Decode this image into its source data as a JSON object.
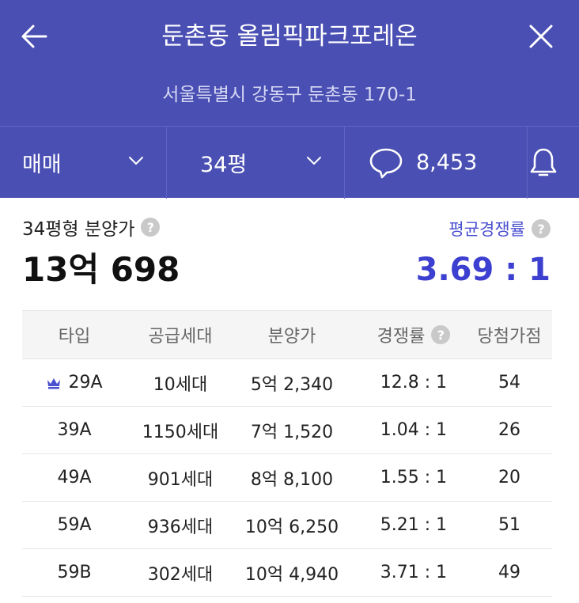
{
  "header": {
    "title": "둔촌동 올림픽파크포레온",
    "address": "서울특별시 강동구 둔촌동 170-1",
    "back_icon": "arrow-left-icon",
    "close_icon": "close-icon"
  },
  "filters": {
    "trade_type": "매매",
    "area": "34평",
    "comment_count": "8,453",
    "comment_icon": "speech-bubble-icon",
    "alarm_icon": "bell-icon"
  },
  "summary": {
    "price_label": "34평형 분양가",
    "price_value": "13억 698",
    "competition_label": "평균경쟁률",
    "competition_value": "3.69 : 1",
    "help_glyph": "?"
  },
  "table": {
    "headers": [
      "타입",
      "공급세대",
      "분양가",
      "경쟁률",
      "당첨가점"
    ],
    "rows": [
      {
        "type": "29A",
        "units": "10세대",
        "price": "5억 2,340",
        "rate": "12.8 : 1",
        "score": "54",
        "crown": true
      },
      {
        "type": "39A",
        "units": "1150세대",
        "price": "7억 1,520",
        "rate": "1.04 : 1",
        "score": "26",
        "crown": false
      },
      {
        "type": "49A",
        "units": "901세대",
        "price": "8억 8,100",
        "rate": "1.55 : 1",
        "score": "20",
        "crown": false
      },
      {
        "type": "59A",
        "units": "936세대",
        "price": "10억 6,250",
        "rate": "5.21 : 1",
        "score": "51",
        "crown": false
      },
      {
        "type": "59B",
        "units": "302세대",
        "price": "10억 4,940",
        "rate": "3.71 : 1",
        "score": "49",
        "crown": false
      }
    ]
  },
  "colors": {
    "header_bg": "#4a4fb3",
    "accent": "#3c3fcf",
    "crown": "#4a4fd0"
  }
}
